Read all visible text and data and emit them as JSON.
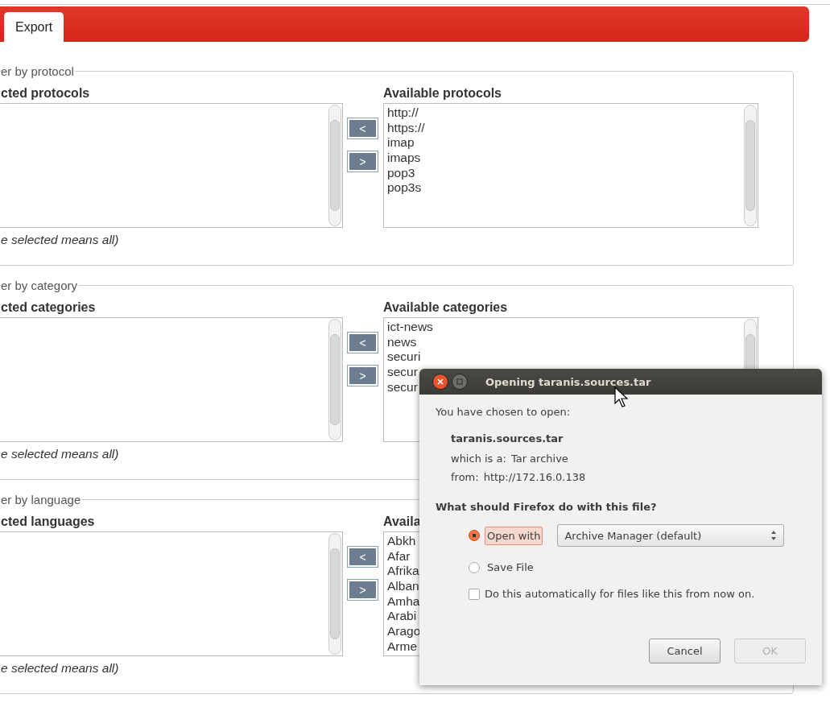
{
  "tabs": [
    {
      "label": "Export",
      "selected": true
    }
  ],
  "sections": [
    {
      "legend": "er by protocol",
      "selected_heading": "cted protocols",
      "move_buttons": [
        "<",
        ">"
      ],
      "available_heading": "Available protocols",
      "available_items": [
        "http://",
        "https://",
        "imap",
        "imaps",
        "pop3",
        "pop3s"
      ],
      "note": "e selected means all)"
    },
    {
      "legend": "er by category",
      "selected_heading": "cted categories",
      "move_buttons": [
        "<",
        ">"
      ],
      "available_heading": "Available categories",
      "available_items": [
        "ict-news",
        "news",
        "securi",
        "secur",
        "secur"
      ],
      "note": "e selected means all)"
    },
    {
      "legend": "er by language",
      "selected_heading": "cted languages",
      "move_buttons": [
        "<",
        ">"
      ],
      "available_heading": "Availa",
      "available_items": [
        "Abkh",
        "Afar",
        "Afrika",
        "Alban",
        "Amha",
        "Arabi",
        "Arago",
        "Arme"
      ],
      "note": "e selected means all)"
    }
  ],
  "dialog": {
    "title": "Opening taranis.sources.tar",
    "intro": "You have chosen to open:",
    "filename": "taranis.sources.tar",
    "fields": [
      {
        "label": "which is a:",
        "value": "Tar archive"
      },
      {
        "label": "from:",
        "value": "http://172.16.0.138"
      }
    ],
    "question": "What should Firefox do with this file?",
    "options": [
      {
        "label": "Open with",
        "selected": true
      },
      {
        "label": "Save File",
        "selected": false
      }
    ],
    "app_select": "Archive Manager (default)",
    "remember": {
      "label": "Do this automatically for files like this from now on.",
      "checked": false
    },
    "buttons": [
      {
        "label": "Cancel",
        "disabled": false
      },
      {
        "label": "OK",
        "disabled": true
      }
    ]
  }
}
